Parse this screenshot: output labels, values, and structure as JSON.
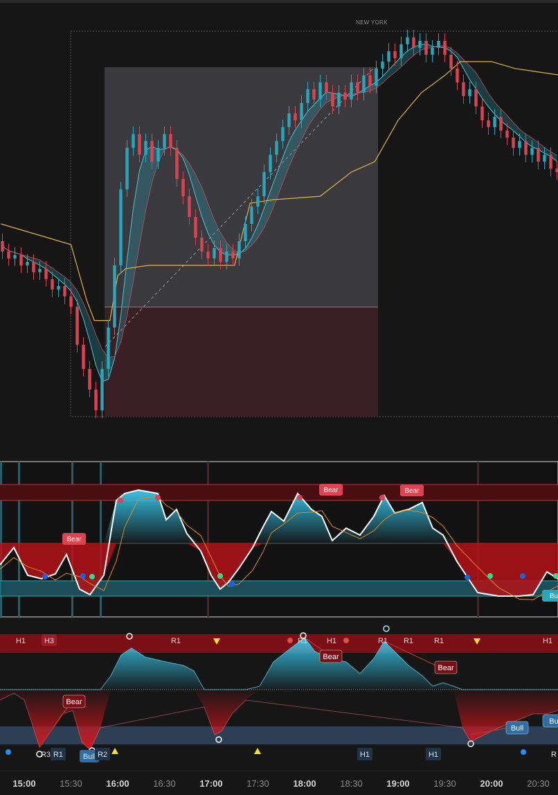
{
  "session_label": "NEW YORK",
  "colors": {
    "bg": "#161616",
    "bull": "#26a8c0",
    "bear": "#e0434f",
    "vwap": "#e3b341",
    "osc_bull": "#35c3e6",
    "osc_bear": "#d4151b",
    "band_red": "#7a0f16",
    "band_blue": "#2d3f54"
  },
  "chart_data": [
    {
      "type": "candlestick",
      "title": "",
      "xlabel": "",
      "ylabel": "",
      "xlim": [
        "14:45",
        "20:45"
      ],
      "ylim": [
        94,
        206
      ],
      "grid": false,
      "series": [
        {
          "kind": "candles",
          "points": [
            [
              "14:46",
              145,
              142
            ],
            [
              "14:50",
              142,
              140
            ],
            [
              "14:54",
              140,
              141
            ],
            [
              "14:58",
              141,
              138
            ],
            [
              "15:02",
              138,
              139
            ],
            [
              "15:06",
              139,
              136
            ],
            [
              "15:10",
              136,
              137
            ],
            [
              "15:14",
              137,
              134
            ],
            [
              "15:18",
              134,
              131
            ],
            [
              "15:22",
              131,
              132
            ],
            [
              "15:26",
              132,
              129
            ],
            [
              "15:30",
              129,
              126
            ],
            [
              "15:34",
              126,
              115
            ],
            [
              "15:38",
              115,
              108
            ],
            [
              "15:42",
              108,
              102
            ],
            [
              "15:46",
              102,
              96
            ],
            [
              "15:50",
              96,
              108
            ],
            [
              "15:54",
              108,
              120
            ],
            [
              "15:58",
              120,
              138
            ],
            [
              "16:02",
              138,
              160
            ],
            [
              "16:06",
              160,
              172
            ],
            [
              "16:10",
              172,
              176
            ],
            [
              "16:14",
              176,
              170
            ],
            [
              "16:18",
              170,
              174
            ],
            [
              "16:22",
              174,
              168
            ],
            [
              "16:26",
              168,
              172
            ],
            [
              "16:30",
              172,
              176
            ],
            [
              "16:34",
              176,
              172
            ],
            [
              "16:38",
              172,
              163
            ],
            [
              "16:42",
              163,
              158
            ],
            [
              "16:46",
              158,
              152
            ],
            [
              "16:50",
              152,
              146
            ],
            [
              "16:54",
              146,
              142
            ],
            [
              "16:58",
              142,
              140
            ],
            [
              "17:02",
              140,
              143
            ],
            [
              "17:06",
              143,
              139
            ],
            [
              "17:10",
              139,
              142
            ],
            [
              "17:14",
              142,
              140
            ],
            [
              "17:18",
              140,
              145
            ],
            [
              "17:22",
              145,
              150
            ],
            [
              "17:26",
              150,
              155
            ],
            [
              "17:30",
              155,
              158
            ],
            [
              "17:34",
              158,
              165
            ],
            [
              "17:38",
              165,
              170
            ],
            [
              "17:42",
              170,
              174
            ],
            [
              "17:46",
              174,
              178
            ],
            [
              "17:50",
              178,
              182
            ],
            [
              "17:54",
              182,
              180
            ],
            [
              "17:58",
              180,
              185
            ],
            [
              "18:02",
              185,
              189
            ],
            [
              "18:06",
              189,
              186
            ],
            [
              "18:10",
              186,
              191
            ],
            [
              "18:14",
              191,
              188
            ],
            [
              "18:18",
              188,
              184
            ],
            [
              "18:22",
              184,
              188
            ],
            [
              "18:26",
              188,
              186
            ],
            [
              "18:30",
              186,
              191
            ],
            [
              "18:34",
              191,
              188
            ],
            [
              "18:38",
              188,
              193
            ],
            [
              "18:42",
              193,
              190
            ],
            [
              "18:46",
              190,
              195
            ],
            [
              "18:50",
              195,
              197
            ],
            [
              "18:54",
              197,
              200
            ],
            [
              "18:58",
              200,
              198
            ],
            [
              "19:02",
              198,
              202
            ],
            [
              "19:06",
              202,
              204
            ],
            [
              "19:10",
              204,
              201
            ],
            [
              "19:14",
              201,
              203
            ],
            [
              "19:18",
              203,
              199
            ],
            [
              "19:22",
              199,
              201
            ],
            [
              "19:26",
              201,
              203
            ],
            [
              "19:30",
              203,
              199
            ],
            [
              "19:34",
              199,
              195
            ],
            [
              "19:38",
              195,
              191
            ],
            [
              "19:42",
              191,
              187
            ],
            [
              "19:46",
              187,
              189
            ],
            [
              "19:50",
              189,
              184
            ],
            [
              "19:54",
              184,
              180
            ],
            [
              "19:58",
              180,
              178
            ],
            [
              "20:02",
              178,
              181
            ],
            [
              "20:06",
              181,
              177
            ],
            [
              "20:10",
              177,
              175
            ],
            [
              "20:14",
              175,
              172
            ],
            [
              "20:18",
              172,
              174
            ],
            [
              "20:22",
              174,
              170
            ],
            [
              "20:26",
              170,
              172
            ],
            [
              "20:30",
              172,
              168
            ],
            [
              "20:34",
              168,
              170
            ],
            [
              "20:38",
              170,
              166
            ],
            [
              "20:42",
              166,
              165
            ]
          ]
        },
        {
          "kind": "line",
          "name": "",
          "points": [
            [
              "14:45",
              150
            ],
            [
              "15:30",
              144
            ],
            [
              "15:40",
              128
            ],
            [
              "15:45",
              122
            ],
            [
              "15:55",
              122
            ],
            [
              "16:00",
              135
            ],
            [
              "16:05",
              137
            ],
            [
              "16:20",
              138
            ],
            [
              "16:30",
              138
            ],
            [
              "17:15",
              138
            ],
            [
              "17:25",
              156
            ],
            [
              "17:40",
              157
            ],
            [
              "18:10",
              158
            ],
            [
              "18:30",
              165
            ],
            [
              "18:45",
              168
            ],
            [
              "19:00",
              180
            ],
            [
              "19:15",
              188
            ],
            [
              "19:30",
              193
            ],
            [
              "19:40",
              197
            ],
            [
              "20:00",
              197
            ],
            [
              "20:15",
              195
            ],
            [
              "20:45",
              193
            ]
          ]
        }
      ],
      "annotations": {
        "session_box": "NEW YORK",
        "range_box": {
          "top": 190,
          "mid": 128,
          "bottom": 94
        }
      }
    },
    {
      "type": "area",
      "title": "",
      "ylim": [
        0,
        100
      ],
      "labels": [
        {
          "x": "15:44",
          "text": "Bear"
        },
        {
          "x": "18:08",
          "text": "Bear"
        },
        {
          "x": "18:55",
          "text": "Bear"
        },
        {
          "x": "20:40",
          "text": "Bu"
        }
      ]
    },
    {
      "type": "area",
      "title": "",
      "ylim": [
        -100,
        100
      ],
      "x_ticks": [
        "15:00",
        "15:30",
        "16:00",
        "16:30",
        "17:00",
        "17:30",
        "18:00",
        "18:30",
        "19:00",
        "19:30",
        "20:00",
        "20:30"
      ],
      "top_band_labels": [
        {
          "x": "14:58",
          "text": "H1"
        },
        {
          "x": "15:11",
          "text": "H3"
        },
        {
          "x": "16:30",
          "text": "R1"
        },
        {
          "x": "18:00",
          "text": "R1"
        },
        {
          "x": "18:19",
          "text": "H1"
        },
        {
          "x": "18:55",
          "text": "R1"
        },
        {
          "x": "19:03",
          "text": "R1"
        },
        {
          "x": "19:30",
          "text": "R1"
        },
        {
          "x": "20:43",
          "text": "H1"
        }
      ],
      "bottom_labels": [
        {
          "x": "15:07",
          "text": "R3"
        },
        {
          "x": "15:13",
          "text": "R1"
        },
        {
          "x": "15:38",
          "text": "Bull"
        },
        {
          "x": "15:44",
          "text": "R2"
        },
        {
          "x": "18:39",
          "text": "H1"
        },
        {
          "x": "19:27",
          "text": "H1"
        },
        {
          "x": "20:45",
          "text": "R"
        }
      ],
      "mid_labels": [
        {
          "x": "15:28",
          "text": "Bear"
        },
        {
          "x": "18:19",
          "text": "Bear"
        },
        {
          "x": "19:30",
          "text": "Bear"
        },
        {
          "x": "20:09",
          "text": "Bull"
        },
        {
          "x": "20:44",
          "text": "Bu"
        }
      ]
    }
  ]
}
